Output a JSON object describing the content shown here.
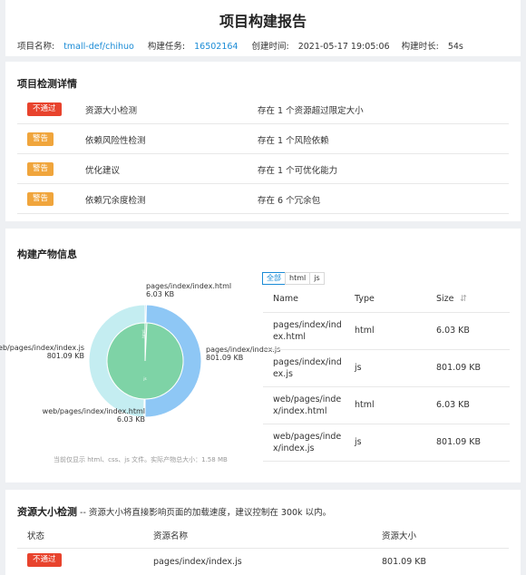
{
  "header": {
    "title": "项目构建报告",
    "project_label": "项目名称:",
    "project_value": "tmall-def/chihuo",
    "task_label": "构建任务:",
    "task_value": "16502164",
    "time_label": "创建时间:",
    "time_value": "2021-05-17 19:05:06",
    "duration_label": "构建时长:",
    "duration_value": "54s"
  },
  "checks": {
    "title": "项目检测详情",
    "rows": [
      {
        "status": "不通过",
        "name": "资源大小检测",
        "desc": "存在 1 个资源超过限定大小"
      },
      {
        "status": "警告",
        "name": "依赖风险性检测",
        "desc": "存在 1 个风险依赖"
      },
      {
        "status": "警告",
        "name": "优化建议",
        "desc": "存在 1 个可优化能力"
      },
      {
        "status": "警告",
        "name": "依赖冗余度检测",
        "desc": "存在 6 个冗余包"
      }
    ]
  },
  "artifacts": {
    "title": "构建产物信息",
    "tabs": [
      "全部",
      "html",
      "js"
    ],
    "active_tab": "全部",
    "columns": [
      "Name",
      "Type",
      "Size"
    ],
    "sort_icon": "sort-icon",
    "rows": [
      {
        "name": "pages/index/index.html",
        "type": "html",
        "size": "6.03 KB"
      },
      {
        "name": "pages/index/index.js",
        "type": "js",
        "size": "801.09 KB"
      },
      {
        "name": "web/pages/index/index.html",
        "type": "html",
        "size": "6.03 KB"
      },
      {
        "name": "web/pages/index/index.js",
        "type": "js",
        "size": "801.09 KB"
      }
    ],
    "note": "当前仅显示 html、css、js 文件。实际产物总大小：1.58 MB"
  },
  "chart_data": {
    "type": "pie",
    "title": "",
    "rings": [
      {
        "name": "inner",
        "slices": [
          {
            "label": "html",
            "value": 6.03
          },
          {
            "label": "js",
            "value": 801.09
          }
        ]
      },
      {
        "name": "outer",
        "slices": [
          {
            "label": "pages/index/index.html",
            "value": 6.03,
            "value_label": "6.03 KB"
          },
          {
            "label": "pages/index/index.js",
            "value": 801.09,
            "value_label": "801.09 KB"
          },
          {
            "label": "web/pages/index/index.html",
            "value": 6.03,
            "value_label": "6.03 KB"
          },
          {
            "label": "web/pages/index/index.js",
            "value": 801.09,
            "value_label": "801.09 KB"
          }
        ]
      }
    ],
    "colors": {
      "inner": "#7ed3a6",
      "outer_a": "#8ec7f5",
      "outer_b": "#c4edf1"
    }
  },
  "sizecheck": {
    "title": "资源大小检测",
    "subtitle": " -- 资源大小将直接影响页面的加载速度，建议控制在 300k 以内。",
    "columns": [
      "状态",
      "资源名称",
      "资源大小"
    ],
    "rows": [
      {
        "status": "不通过",
        "name": "pages/index/index.js",
        "size": "801.09 KB"
      }
    ]
  },
  "colors": {
    "link": "#1a8bd6",
    "fail": "#e8432d",
    "warn": "#f0a53c"
  }
}
